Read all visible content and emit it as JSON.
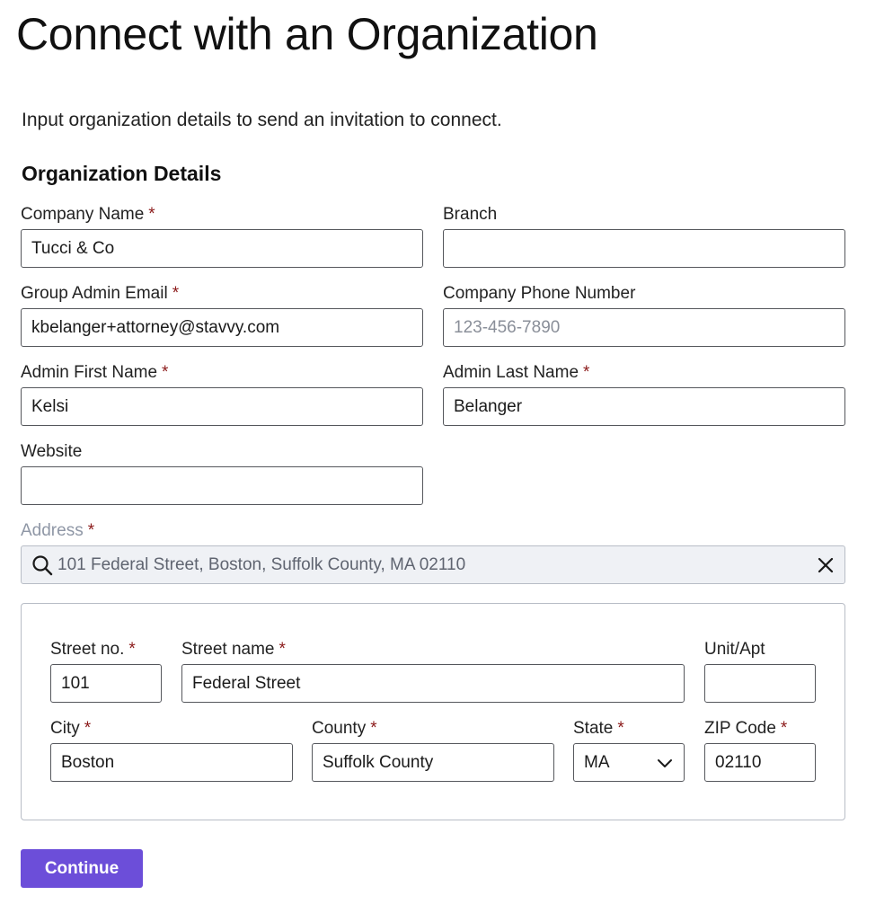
{
  "page": {
    "title": "Connect with an Organization",
    "intro": "Input organization details to send an invitation to connect.",
    "section_heading": "Organization Details"
  },
  "required_marker": "*",
  "fields": {
    "company_name": {
      "label": "Company Name",
      "value": "Tucci & Co",
      "placeholder": ""
    },
    "branch": {
      "label": "Branch",
      "value": "",
      "placeholder": ""
    },
    "group_admin_email": {
      "label": "Group Admin Email",
      "value": "kbelanger+attorney@stavvy.com",
      "placeholder": ""
    },
    "company_phone": {
      "label": "Company Phone Number",
      "value": "",
      "placeholder": "123-456-7890"
    },
    "admin_first_name": {
      "label": "Admin First Name",
      "value": "Kelsi",
      "placeholder": ""
    },
    "admin_last_name": {
      "label": "Admin Last Name",
      "value": "Belanger",
      "placeholder": ""
    },
    "website": {
      "label": "Website",
      "value": "",
      "placeholder": ""
    }
  },
  "address": {
    "label": "Address",
    "value": "101 Federal Street, Boston, Suffolk County, MA 02110",
    "search_icon": "search-icon",
    "clear_icon": "close-icon"
  },
  "address_detail": {
    "street_no": {
      "label": "Street no.",
      "value": "101"
    },
    "street_name": {
      "label": "Street name",
      "value": "Federal Street"
    },
    "unit_apt": {
      "label": "Unit/Apt",
      "value": ""
    },
    "city": {
      "label": "City",
      "value": "Boston"
    },
    "county": {
      "label": "County",
      "value": "Suffolk County"
    },
    "state": {
      "label": "State",
      "value": "MA",
      "icon": "chevron-down-icon"
    },
    "zip": {
      "label": "ZIP Code",
      "value": "02110"
    }
  },
  "continue_label": "Continue",
  "colors": {
    "primary_button": "#6c4ed9",
    "required_asterisk": "#8b1a1a",
    "address_bg": "#eff1f5",
    "input_border": "#55575c"
  }
}
